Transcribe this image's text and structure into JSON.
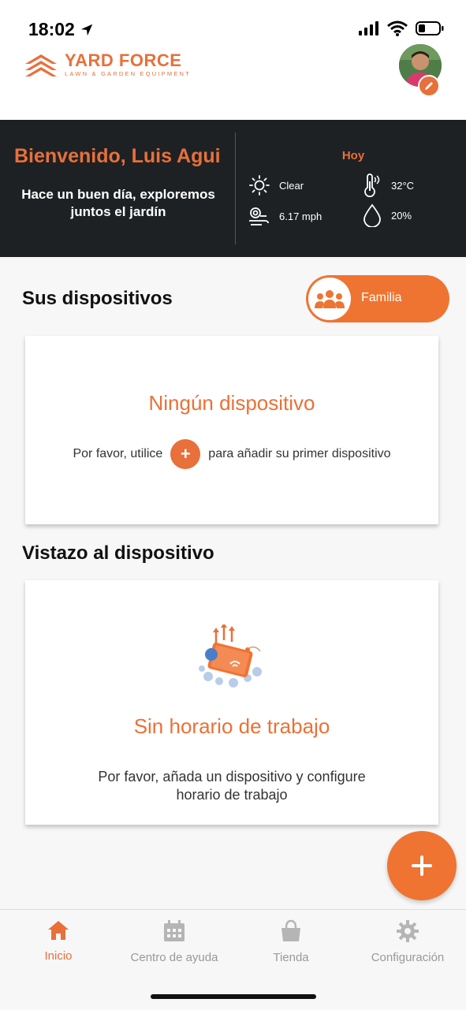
{
  "status": {
    "time": "18:02"
  },
  "brand": {
    "name": "YARD FORCE",
    "tagline": "LAWN & GARDEN EQUIPMENT",
    "accent": "#e8703a"
  },
  "welcome": {
    "title": "Bienvenido, Luis Agui",
    "subtitle_line1": "Hace un buen día, exploremos",
    "subtitle_line2": "juntos el jardín"
  },
  "weather": {
    "today_label": "Hoy",
    "condition": "Clear",
    "temperature": "32°C",
    "wind": "6.17 mph",
    "humidity": "20%"
  },
  "devices": {
    "section_title": "Sus dispositivos",
    "family_button": "Familia",
    "empty_title": "Ningún dispositivo",
    "empty_text_before": "Por favor, utilice",
    "empty_text_after": "para añadir su primer dispositivo",
    "inline_plus": "+"
  },
  "overview": {
    "section_title": "Vistazo al dispositivo",
    "empty_title": "Sin horario de trabajo",
    "empty_line1": "Por favor, añada un dispositivo y configure",
    "empty_line2": "horario de trabajo"
  },
  "tabs": [
    {
      "label": "Inicio",
      "icon": "home-icon",
      "active": true
    },
    {
      "label": "Centro de ayuda",
      "icon": "calendar-icon",
      "active": false
    },
    {
      "label": "Tienda",
      "icon": "shopping-bag-icon",
      "active": false
    },
    {
      "label": "Configuración",
      "icon": "gear-icon",
      "active": false
    }
  ]
}
